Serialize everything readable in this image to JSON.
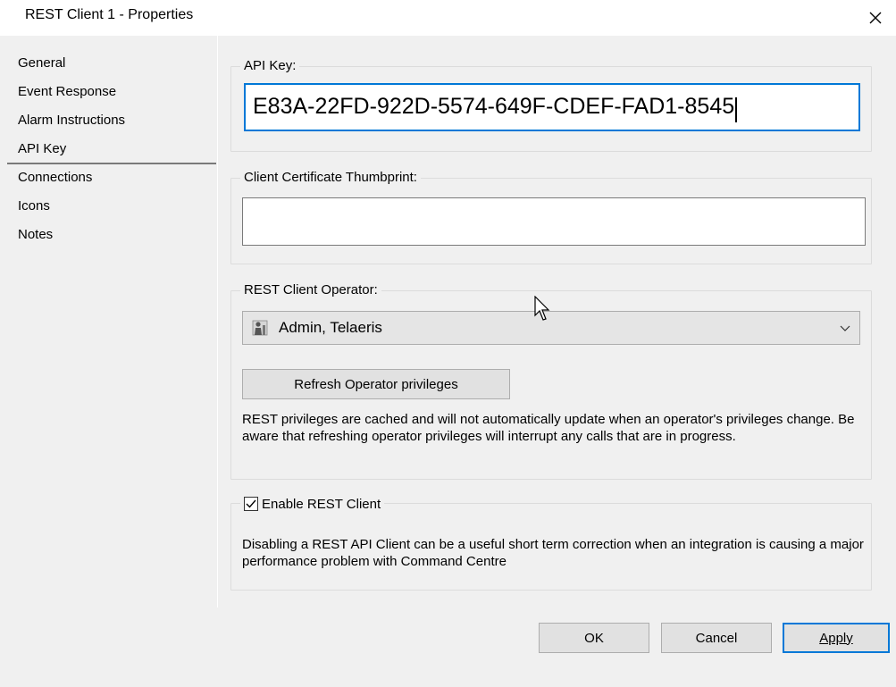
{
  "window": {
    "title": "REST Client 1 - Properties"
  },
  "nav": {
    "items": [
      {
        "label": "General"
      },
      {
        "label": "Event Response"
      },
      {
        "label": "Alarm Instructions"
      },
      {
        "label": "API Key",
        "selected": true
      },
      {
        "label": "Connections"
      },
      {
        "label": "Icons"
      },
      {
        "label": "Notes"
      }
    ]
  },
  "api_key": {
    "group_title": "API Key:",
    "value": "E83A-22FD-922D-5574-649F-CDEF-FAD1-8545"
  },
  "thumbprint": {
    "group_title": "Client Certificate Thumbprint:",
    "value": ""
  },
  "operator": {
    "group_title": "REST Client Operator:",
    "selected": "Admin, Telaeris",
    "refresh_label": "Refresh Operator privileges",
    "note": "REST privileges are cached and will not automatically update when an operator's privileges change. Be aware that refreshing operator privileges will interrupt any calls that are in progress."
  },
  "enable": {
    "label": "Enable REST Client",
    "checked": true,
    "note": "Disabling a REST API Client can be a useful short term correction when an integration is causing a major performance problem with Command Centre"
  },
  "buttons": {
    "ok": "OK",
    "cancel": "Cancel",
    "apply": "Apply"
  },
  "colors": {
    "accent": "#0078d7",
    "panel": "#f0f0f0"
  }
}
